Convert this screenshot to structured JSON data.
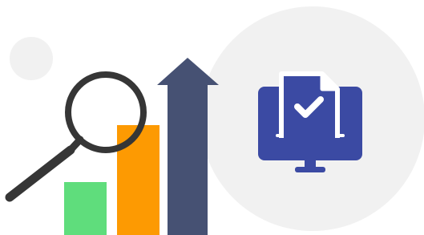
{
  "illustration": {
    "colors": {
      "background_circle": "#f1f1f1",
      "bar_low": "#5fdd7c",
      "bar_mid": "#fd9a02",
      "arrow": "#465173",
      "magnifier": "#363636",
      "monitor": "#3b4aa3",
      "monitor_detail": "#ffffff"
    },
    "icons": {
      "magnifier": "magnifying-glass-icon",
      "growth_arrow": "arrow-up-icon",
      "monitor": "monitor-document-check-icon"
    }
  }
}
